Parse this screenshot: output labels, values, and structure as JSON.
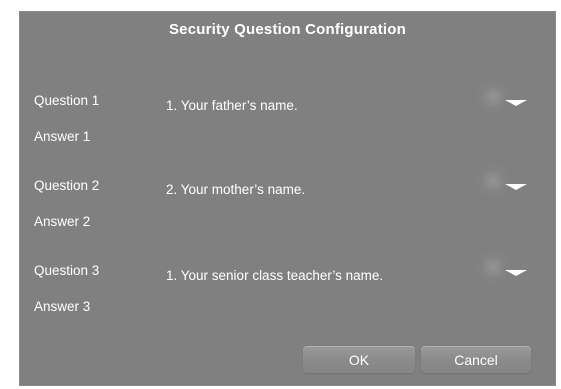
{
  "dialog": {
    "title": "Security Question Configuration"
  },
  "questions": [
    {
      "label": "Question 1",
      "selected": "1. Your father’s name.",
      "answer_label": "Answer 1",
      "answer_value": ""
    },
    {
      "label": "Question 2",
      "selected": "2. Your mother’s name.",
      "answer_label": "Answer 2",
      "answer_value": ""
    },
    {
      "label": "Question 3",
      "selected": "1. Your senior class teacher’s name.",
      "answer_label": "Answer 3",
      "answer_value": ""
    }
  ],
  "buttons": {
    "ok": "OK",
    "cancel": "Cancel"
  },
  "icons": {
    "dropdown": "chevron-down-icon"
  },
  "colors": {
    "dialog_bg": "#808080",
    "text": "#ffffff"
  }
}
